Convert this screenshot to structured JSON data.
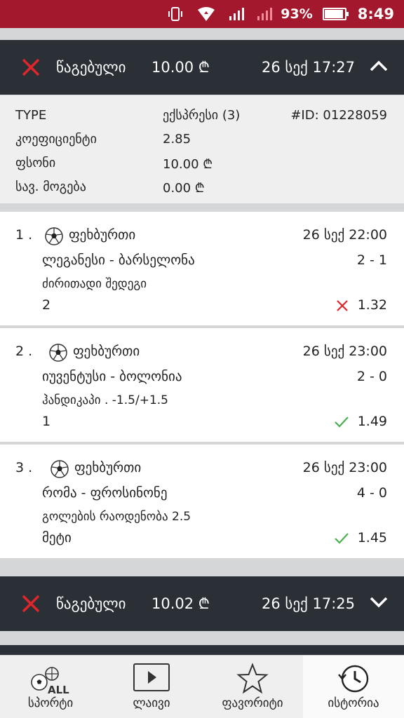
{
  "status_bar": {
    "battery": "93%",
    "time": "8:49",
    "battery_level": 0.93
  },
  "bets": [
    {
      "status_icon": "close-icon",
      "status": "წაგებული",
      "amount": "10.00 ₾",
      "date": "26 სექ 17:27",
      "expanded": true,
      "summary": {
        "type_label": "TYPE",
        "type_value": "ექსპრესი (3)",
        "id": "#ID: 01228059",
        "coef_label": "კოეფიციენტი",
        "coef_value": "2.85",
        "stake_label": "ფსონი",
        "stake_value": "10.00 ₾",
        "payout_label": "სავ. მოგება",
        "payout_value": "0.00 ₾"
      },
      "events": [
        {
          "num": "1 .",
          "sport": "ფეხბურთი",
          "time": "26 სექ 22:00",
          "teams": "ლეგანესი - ბარსელონა",
          "score": "2 - 1",
          "market": "ძირითადი შედეგი",
          "pick": "2",
          "result": "lost",
          "odd": "1.32"
        },
        {
          "num": "2 .",
          "sport": "ფეხბურთი",
          "time": "26 სექ 23:00",
          "teams": "იუვენტუსი - ბოლონია",
          "score": "2 - 0",
          "market": "ჰანდიკაპი . -1.5/+1.5",
          "pick": "1",
          "result": "won",
          "odd": "1.49"
        },
        {
          "num": "3 .",
          "sport": "ფეხბურთი",
          "time": "26 სექ 23:00",
          "teams": "რომა - ფროსინონე",
          "score": "4 - 0",
          "market": "გოლების რაოდენობა 2.5",
          "pick": "მეტი",
          "result": "won",
          "odd": "1.45"
        }
      ]
    },
    {
      "status_icon": "close-icon",
      "status": "წაგებული",
      "amount": "10.02 ₾",
      "date": "26 სექ 17:25",
      "expanded": false
    }
  ],
  "nav": [
    {
      "label": "სპორტი",
      "icon": "sports-all-icon",
      "active": false
    },
    {
      "label": "ლაივი",
      "icon": "play-icon",
      "active": false
    },
    {
      "label": "ფავორიტი",
      "icon": "star-icon",
      "active": false
    },
    {
      "label": "ისტორია",
      "icon": "history-icon",
      "active": true
    }
  ],
  "colors": {
    "status_bar": "#a3182c",
    "header": "#2b2f36",
    "lost": "#e0262b",
    "won": "#4caf50"
  }
}
